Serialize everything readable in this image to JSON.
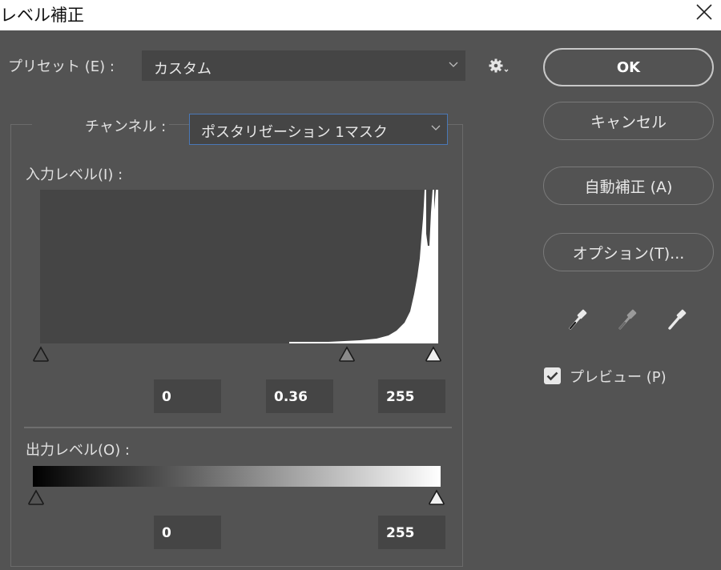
{
  "window": {
    "title": "レベル補正"
  },
  "preset": {
    "label": "プリセット (E) :",
    "value": "カスタム"
  },
  "channel": {
    "label": "チャンネル :",
    "value": "ポスタリゼーション 1マスク"
  },
  "input_levels": {
    "label": "入力レベル(I) :",
    "black": "0",
    "gamma": "0.36",
    "white": "255"
  },
  "output_levels": {
    "label": "出力レベル(O) :",
    "black": "0",
    "white": "255"
  },
  "buttons": {
    "ok": "OK",
    "cancel": "キャンセル",
    "auto": "自動補正 (A)",
    "options": "オプション(T)..."
  },
  "preview": {
    "label": "プレビュー (P)",
    "checked": true
  },
  "icons": {
    "close": "close-icon",
    "settings": "gear-icon",
    "black_point": "eyedropper-black-icon",
    "gray_point": "eyedropper-gray-icon",
    "white_point": "eyedropper-white-icon"
  },
  "colors": {
    "background": "#535353",
    "field": "#454545",
    "focus_border": "#4a78b6"
  }
}
